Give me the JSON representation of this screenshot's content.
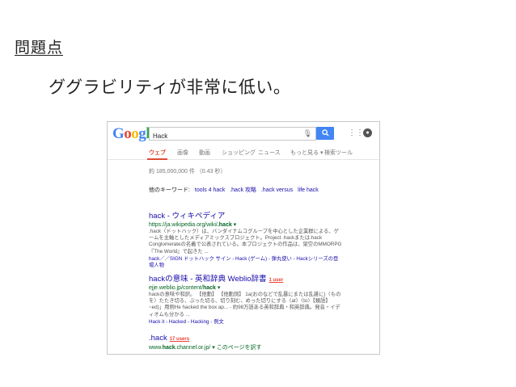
{
  "slide": {
    "heading": "問題点",
    "text": "ググラビリティが非常に低い。"
  },
  "search": {
    "logo": [
      "G",
      "o",
      "o",
      "g",
      "l",
      "e"
    ],
    "query": "Hack"
  },
  "tabs": [
    "ウェブ",
    "画像",
    "動画",
    "ショッピング",
    "ニュース",
    "もっと見る ▾",
    "検索ツール"
  ],
  "stats": "約 185,000,000 件 （0.43 秒）",
  "related": {
    "label": "他のキーワード:",
    "links": [
      "tools 4 hack",
      ".hack 攻略",
      ".hack versus",
      "life hack"
    ]
  },
  "results": [
    {
      "title": "hack - ウィキペディア",
      "url_prefix": "https://ja.wikipedia.org/wiki/",
      "url_bold": ".hack",
      "url_suffix": " ▾",
      "snippet": ".hack（ドットハック）は、バンダイナムコグループを中心とした企業群による、ゲームを主軸としたメディアミックスプロジェクト。Project .hackまたは.hack Conglomerateの名義で公表されている。本プロジェクトの作品は、架空のMMORPG『The World』で起きた ...",
      "sub": "hack／／SIGN ドットハック サイン - Hack (ゲーム) - 弾丸使い - Hackシリーズの登場人物"
    },
    {
      "title": "hackの意味 - 英和辞典 Weblio辞書",
      "badge": "1 user",
      "url_prefix": "ejje.weblio.jp/content/",
      "url_bold": "hack",
      "url_suffix": " ▾",
      "snippet": "hackの意味や和訳。 【他動】 【他動詞】 1a(おのなどで乱暴にまたは乱雑に)〈ものを〉たたき切る、ぶった切る、切り刻む、めった切りにする〈at〉〈to〉【類語】 ~ed)」用例He hacked the box ap... - 約98万語ある英和辞典・和英辞典。発音・イディオムも分かる ...",
      "sub": "Hack it - Hacked - Hacking - 例文"
    },
    {
      "title": ".hack",
      "badge": "17 users",
      "url_prefix": "www.",
      "url_bold": "hack",
      "url_suffix": ".channel.or.jp/ ▾  このページを訳す"
    }
  ]
}
